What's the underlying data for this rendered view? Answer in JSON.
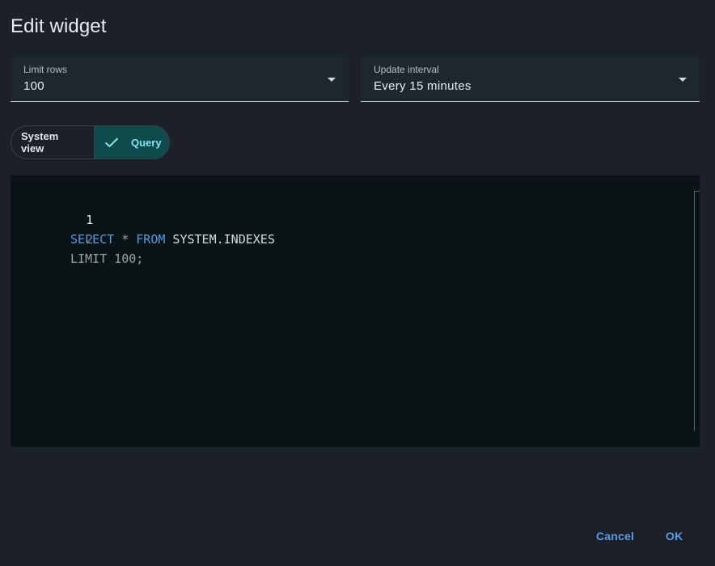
{
  "dialog": {
    "title": "Edit widget"
  },
  "fields": {
    "limit_rows": {
      "label": "Limit rows",
      "value": "100"
    },
    "update_interval": {
      "label": "Update interval",
      "value": "Every 15 minutes"
    }
  },
  "mode_toggle": {
    "system_view_label": "System view",
    "query_label": "Query",
    "selected": "Query"
  },
  "editor": {
    "lines": [
      {
        "number": "1",
        "tokens": [
          {
            "text": "SELECT",
            "kind": "keyword"
          },
          {
            "text": " * ",
            "kind": "operator"
          },
          {
            "text": "FROM",
            "kind": "keyword"
          },
          {
            "text": " SYSTEM.INDEXES",
            "kind": "identifier"
          }
        ]
      },
      {
        "number": "2",
        "text": "LIMIT 100;"
      }
    ]
  },
  "actions": {
    "cancel_label": "Cancel",
    "ok_label": "OK"
  },
  "colors": {
    "background": "#1b202a",
    "accent": "#5d9ce6",
    "toggle_selected_bg": "#0f4a4d",
    "toggle_selected_text": "#86e4ee",
    "editor_bg": "#0b1317",
    "keyword": "#4f9ee6"
  },
  "icons": {
    "field_dropdown": "caret-down-icon",
    "toggle_selected": "check-icon"
  }
}
